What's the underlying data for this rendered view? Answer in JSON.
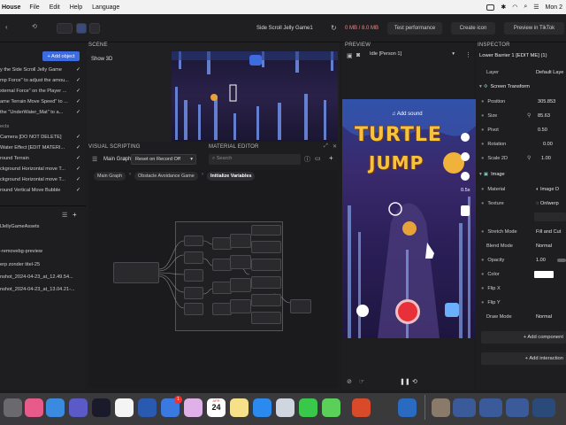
{
  "menubar": {
    "app": "House",
    "items": [
      "File",
      "Edit",
      "Help",
      "Language"
    ],
    "clock": "Mon 2"
  },
  "toolbar": {
    "project_title": "Side Scroll Jelly Game1",
    "memory": "0 MB / 8.0 MB",
    "test_label": "Test performance",
    "create_icon_label": "Create icon",
    "preview_label": "Preview in TikTok"
  },
  "left": {
    "add_object_label": "+ Add object",
    "objects": [
      "y the Side Scroll Jelly Game",
      "mp Force\" to adjust the amou...",
      "xternal Force\" on the Player ...",
      "ame Terrain Move Speed\" to ...",
      "the \"UnderWater_Mat\" to a...",
      "ects",
      "Camera [DO NOT DELETE]",
      "Water Effect [EDIT MATERI...",
      "round Terrain",
      "ckground Horizontal move T...",
      "ckground Horizontal move T...",
      "round Vertical Move Bubble"
    ],
    "assets": [
      "lJellyGameAssets",
      "-removebg-preview",
      "erp zonder titel-25",
      "nshot_2024-04-23_at_12.49.54...",
      "nshot_2024-04-23_at_13.04.21-..."
    ]
  },
  "scene": {
    "header": "SCENE",
    "show3d": "Show 3D"
  },
  "vs": {
    "header": "VISUAL SCRIPTING",
    "material_header": "MATERIAL EDITOR",
    "main_graph": "Main Graph",
    "reset_select": "Reset on Record Off",
    "search_placeholder": "Search",
    "breadcrumb": [
      "Main Graph",
      "Obstacle Avoidance Game",
      "Initialize Variables"
    ]
  },
  "preview": {
    "header": "PREVIEW",
    "person_select": "Idle [Person 1]",
    "add_sound": "Add sound",
    "game_title_1": "TURTLE",
    "game_title_2": "JUMP",
    "speed": "0.5x"
  },
  "inspector": {
    "header": "INSPECTOR",
    "object_name": "Lower Barrier 1 [EDIT ME] (1)",
    "layer_label": "Layer",
    "layer_value": "Default Laye",
    "screen_transform": "Screen Transform",
    "position_label": "Position",
    "position_value": "305.853",
    "size_label": "Size",
    "size_value": "85.63",
    "pivot_label": "Pivot",
    "pivot_value": "0.50",
    "rotation_label": "Rotation",
    "rotation_value": "0.00",
    "scale_label": "Scale 2D",
    "scale_value": "1.00",
    "image_label": "Image",
    "material_label": "Material",
    "material_value": "Image D",
    "texture_label": "Texture",
    "texture_value": "Onlwerp",
    "stretch_label": "Stretch Mode",
    "stretch_value": "Fill and Cut",
    "blend_label": "Blend Mode",
    "blend_value": "Normal",
    "opacity_label": "Opacity",
    "opacity_value": "1.00",
    "color_label": "Color",
    "flipx_label": "Flip X",
    "flipy_label": "Flip Y",
    "draw_label": "Draw Mode",
    "draw_value": "Normal",
    "add_component": "+ Add component",
    "add_interaction": "+ Add interaction"
  },
  "dock": {
    "calendar_day": "24",
    "calendar_month": "APR",
    "badge": "1"
  }
}
